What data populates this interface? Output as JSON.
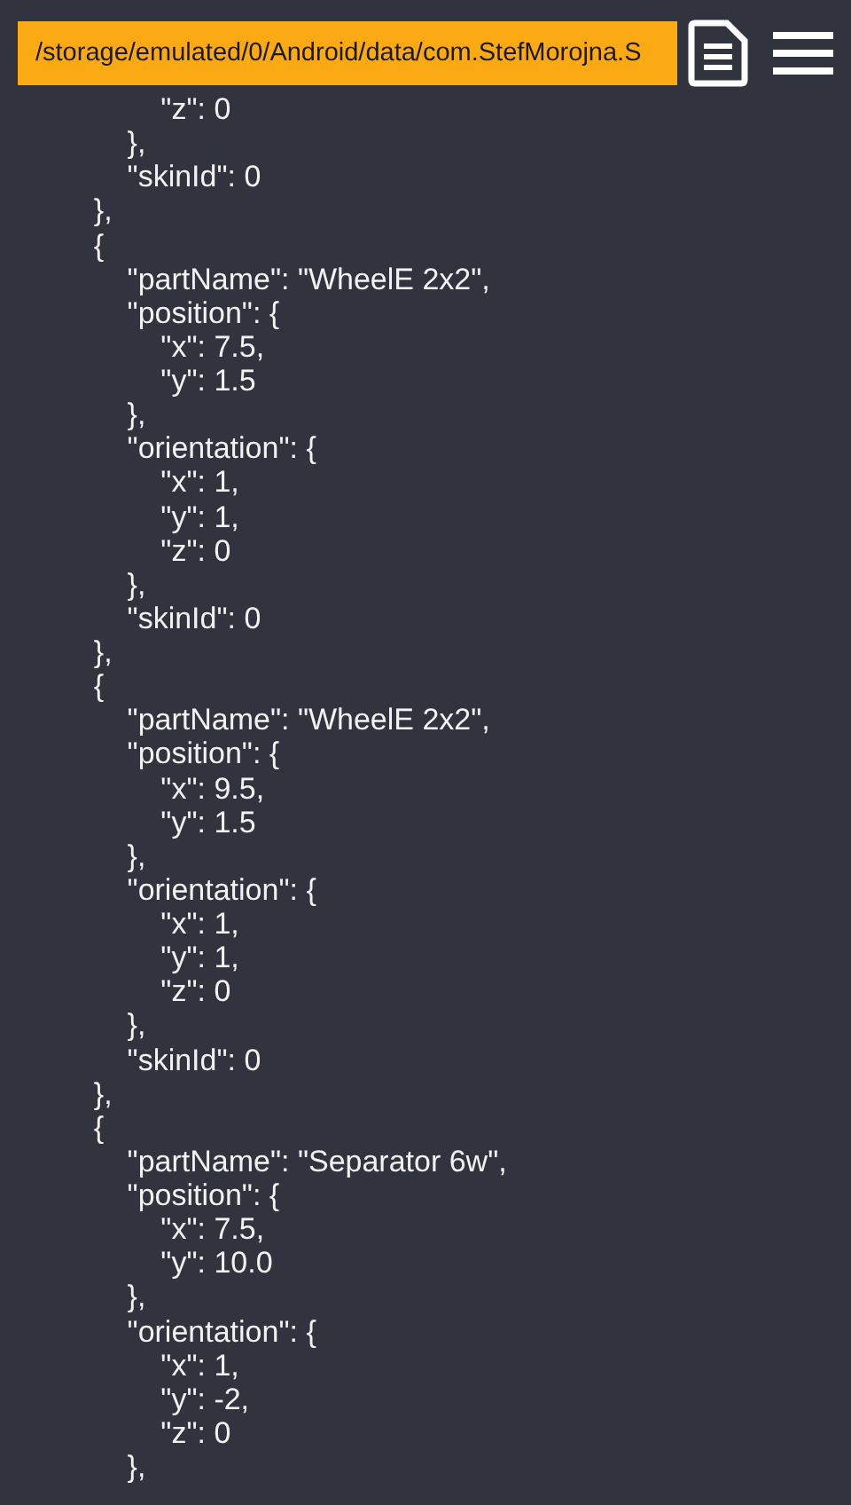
{
  "path_field": {
    "value": "/storage/emulated/0/Android/data/com.StefMorojna.S"
  },
  "code_lines": [
    "            \"z\": 0",
    "        },",
    "        \"skinId\": 0",
    "    },",
    "    {",
    "        \"partName\": \"WheelE 2x2\",",
    "        \"position\": {",
    "            \"x\": 7.5,",
    "            \"y\": 1.5",
    "        },",
    "        \"orientation\": {",
    "            \"x\": 1,",
    "            \"y\": 1,",
    "            \"z\": 0",
    "        },",
    "        \"skinId\": 0",
    "    },",
    "    {",
    "        \"partName\": \"WheelE 2x2\",",
    "        \"position\": {",
    "            \"x\": 9.5,",
    "            \"y\": 1.5",
    "        },",
    "        \"orientation\": {",
    "            \"x\": 1,",
    "            \"y\": 1,",
    "            \"z\": 0",
    "        },",
    "        \"skinId\": 0",
    "    },",
    "    {",
    "        \"partName\": \"Separator 6w\",",
    "        \"position\": {",
    "            \"x\": 7.5,",
    "            \"y\": 10.0",
    "        },",
    "        \"orientation\": {",
    "            \"x\": 1,",
    "            \"y\": -2,",
    "            \"z\": 0",
    "        },"
  ]
}
